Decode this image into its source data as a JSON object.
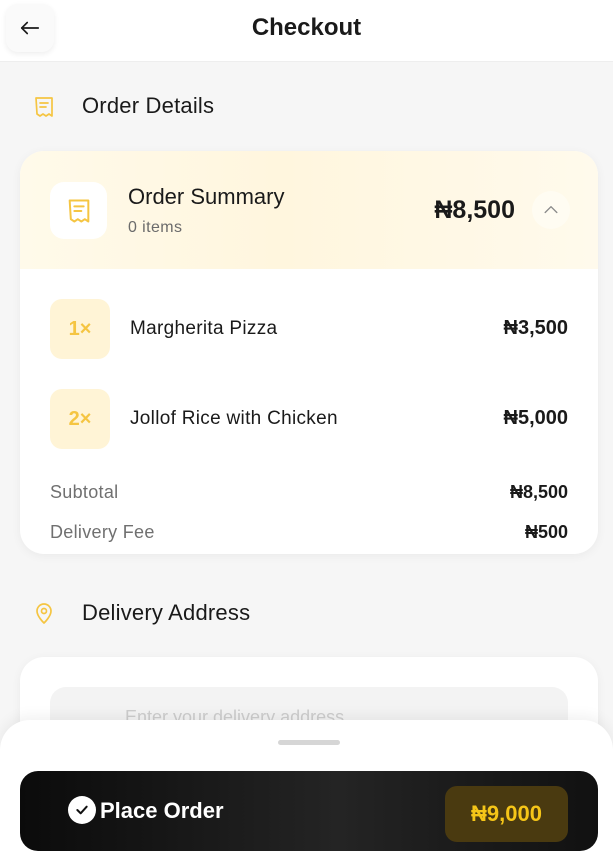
{
  "header": {
    "title": "Checkout",
    "back_icon": "arrow-left-icon"
  },
  "order_details": {
    "title": "Order Details",
    "icon": "receipt-icon"
  },
  "order_summary": {
    "title": "Order Summary",
    "count": "0 items",
    "total": "₦8,500",
    "icon": "receipt-icon",
    "collapse_icon": "chevron-up-icon",
    "items": [
      {
        "qty": "1×",
        "name": "Margherita Pizza",
        "price": "₦3,500"
      },
      {
        "qty": "2×",
        "name": "Jollof Rice with Chicken",
        "price": "₦5,000"
      }
    ],
    "subtotal_label": "Subtotal",
    "subtotal_value": "₦8,500",
    "delivery_label": "Delivery Fee",
    "delivery_value": "₦500"
  },
  "delivery": {
    "title": "Delivery Address",
    "icon": "map-pin-icon",
    "placeholder": "Enter your delivery address"
  },
  "footer": {
    "button_label": "Place Order",
    "total": "₦9,000",
    "check_icon": "check-circle-icon"
  },
  "colors": {
    "accent": "#f5c542",
    "accent_dark": "#4a3a10",
    "button_bg": "#111111"
  }
}
